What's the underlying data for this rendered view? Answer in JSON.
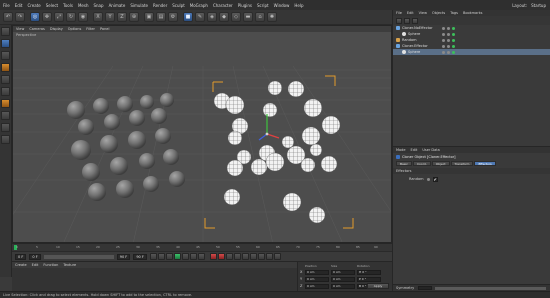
{
  "menubar": {
    "items": [
      "File",
      "Edit",
      "Create",
      "Select",
      "Tools",
      "Mesh",
      "Snap",
      "Animate",
      "Simulate",
      "Render",
      "Sculpt",
      "MoGraph",
      "Character",
      "Plugins",
      "Script",
      "Window",
      "Help"
    ],
    "layout_label": "Layout:",
    "layout_value": "Startup"
  },
  "object_manager": {
    "menu": [
      "File",
      "Edit",
      "View",
      "Objects",
      "Tags",
      "Bookmarks"
    ],
    "objects": [
      {
        "name": "Cloner.NoEffector",
        "icon_color": "#6aa4e0"
      },
      {
        "name": "Sphere",
        "icon_color": "#e0e0e0"
      },
      {
        "name": "Random",
        "icon_color": "#d6a04a"
      },
      {
        "name": "Cloner.Effector",
        "icon_color": "#6aa4e0"
      },
      {
        "name": "Sphere",
        "icon_color": "#e0e0e0"
      }
    ]
  },
  "attribute_manager": {
    "menu": [
      "Mode",
      "Edit",
      "User Data"
    ],
    "title": "Cloner Object [Cloner.Effector]",
    "tabs": [
      "Basic",
      "Coord.",
      "Object",
      "Transform",
      "Effectors"
    ],
    "active_tab": "Effectors",
    "section": "Effectors",
    "field_label": "Random",
    "field_check": "✔",
    "bottom_label": "Symmetry"
  },
  "viewport": {
    "menu": [
      "View",
      "Cameras",
      "Display",
      "Options",
      "Filter",
      "Panel"
    ],
    "label": "Perspective"
  },
  "timeline": {
    "start": "0",
    "end": "90 F",
    "ticks": [
      "0",
      "5",
      "10",
      "15",
      "20",
      "25",
      "30",
      "35",
      "40",
      "45",
      "50",
      "55",
      "60",
      "65",
      "70",
      "75",
      "80",
      "85",
      "90"
    ]
  },
  "transport": {
    "current_frame": "0 F",
    "min_frame": "0 F",
    "max_frame": "90 F",
    "end_frame": "90 F"
  },
  "material_panel": {
    "menu": [
      "Create",
      "Edit",
      "Function",
      "Texture"
    ]
  },
  "coordinates": {
    "headers": [
      "Position",
      "Size",
      "Rotation"
    ],
    "rows": [
      {
        "axis": "X",
        "values": [
          "0 cm",
          "0 cm",
          "H 0 °"
        ]
      },
      {
        "axis": "Y",
        "values": [
          "0 cm",
          "0 cm",
          "P 0 °"
        ]
      },
      {
        "axis": "Z",
        "values": [
          "0 cm",
          "0 cm",
          "B 0 °"
        ]
      }
    ],
    "mode": "Object (Rel)",
    "apply_label": "Apply"
  },
  "statusbar": {
    "text": "Live Selection: Click and drag to select elements. Hold down SHIFT to add to the selection, CTRL to remove."
  }
}
